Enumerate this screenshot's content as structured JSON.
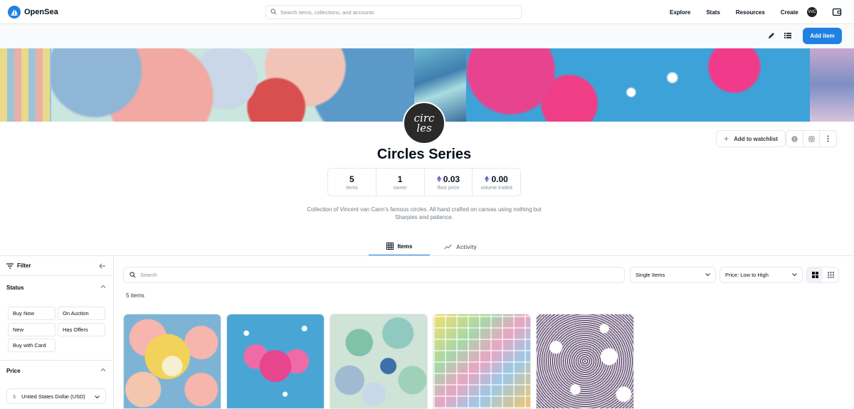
{
  "nav": {
    "brand": "OpenSea",
    "search_placeholder": "Search items, collections, and accounts",
    "links": [
      "Explore",
      "Stats",
      "Resources",
      "Create"
    ],
    "avatar_text": "VvC"
  },
  "toolbar": {
    "add_item_label": "Add item"
  },
  "collection": {
    "avatar_text_line1": "circ",
    "avatar_text_line2": "les",
    "title": "Circles Series",
    "watchlist_label": "Add to watchlist",
    "stats": [
      {
        "value": "5",
        "label": "items",
        "eth": false
      },
      {
        "value": "1",
        "label": "owner",
        "eth": false
      },
      {
        "value": "0.03",
        "label": "floor price",
        "eth": true
      },
      {
        "value": "0.00",
        "label": "volume traded",
        "eth": true
      }
    ],
    "description": "Collection of Vincent van Cann's famous circles. All hand crafted on canvas using nothing but Sharpies and patience."
  },
  "tabs": [
    {
      "label": "Items",
      "active": true
    },
    {
      "label": "Activity",
      "active": false
    }
  ],
  "sidebar": {
    "filter_label": "Filter",
    "status_label": "Status",
    "status_options": [
      "Buy Now",
      "On Auction",
      "New",
      "Has Offers",
      "Buy with Card"
    ],
    "price_label": "Price",
    "currency": "United States Dollar (USD)",
    "currency_symbol": "$"
  },
  "main": {
    "search_placeholder": "Search",
    "item_type": "Single Items",
    "sort": "Price: Low to High",
    "count_text": "5 items"
  },
  "colors": {
    "accent": "#2081e2",
    "text": "#04111d",
    "muted": "#8a939b",
    "border": "#e5e8eb",
    "eth": "#6b5ccf"
  }
}
